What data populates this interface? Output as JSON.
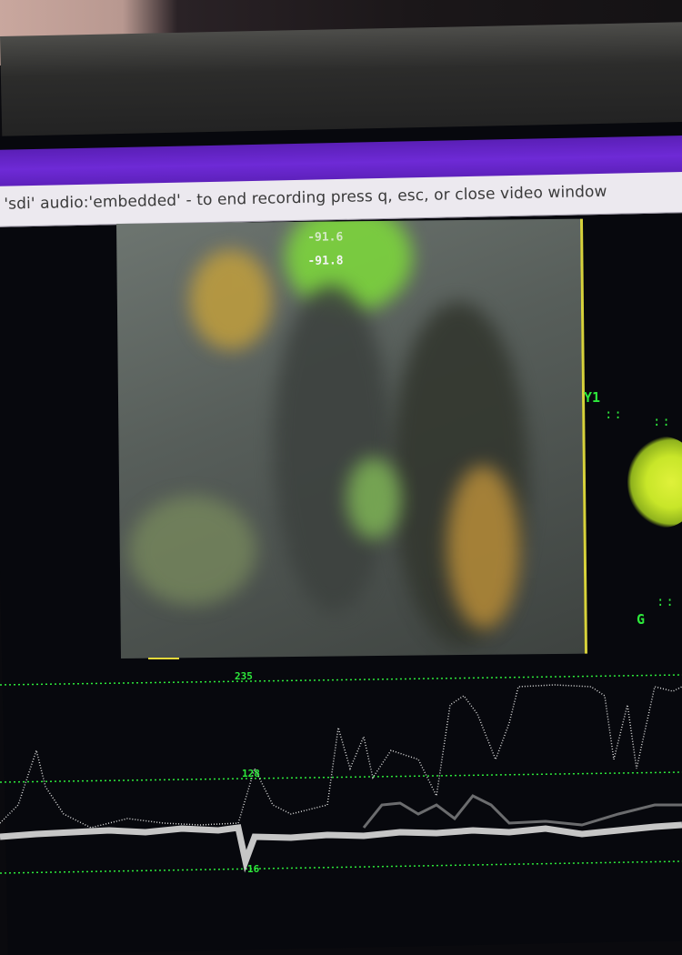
{
  "window": {
    "title_text": "'sdi' audio:'embedded' - to end recording press q, esc, or close video window"
  },
  "video": {
    "overlay_line1": "-91.6",
    "overlay_line2": "-91.8"
  },
  "vectorscope": {
    "label_y1": "Y1",
    "label_g": "G"
  },
  "waveform": {
    "label_high": "235",
    "label_mid": "128",
    "label_low": "16"
  },
  "colors": {
    "title_bar_accent": "#6e2ad6",
    "scope_green": "#2de93b",
    "vectorscope_yellow": "#d8ee32",
    "video_border": "#d7d23b"
  }
}
